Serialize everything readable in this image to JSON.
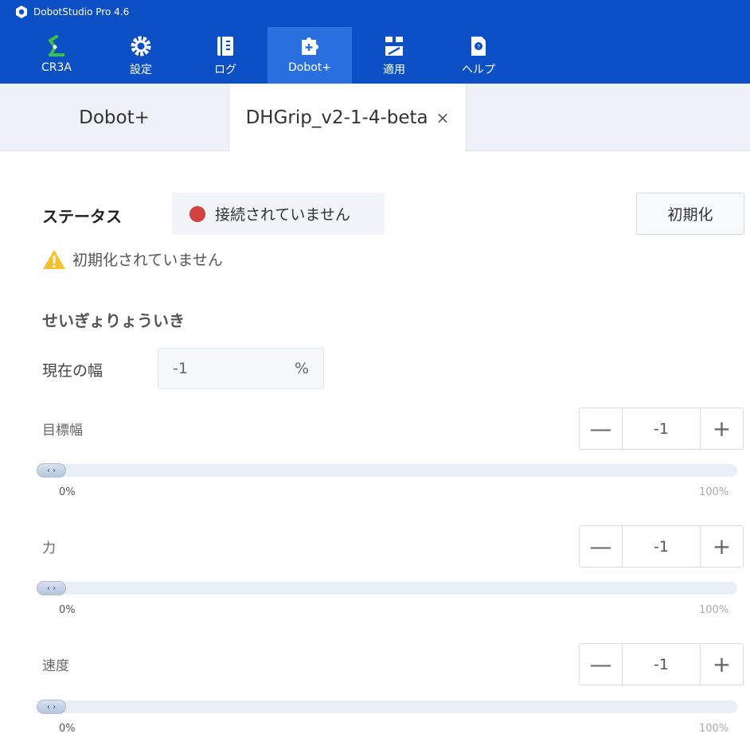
{
  "app": {
    "title": "DobotStudio Pro 4.6"
  },
  "nav": [
    {
      "label": "CR3A",
      "icon": "robot-arm-icon"
    },
    {
      "label": "設定",
      "icon": "gear-icon"
    },
    {
      "label": "ログ",
      "icon": "log-book-icon"
    },
    {
      "label": "Dobot+",
      "icon": "puzzle-plus-icon",
      "active": true
    },
    {
      "label": "適用",
      "icon": "apply-blocks-icon"
    },
    {
      "label": "ヘルプ",
      "icon": "help-doc-icon"
    }
  ],
  "tabs": [
    {
      "label": "Dobot+"
    },
    {
      "label": "DHGrip_v2-1-4-beta",
      "close": "×",
      "active": true
    }
  ],
  "status": {
    "heading": "ステータス",
    "value": "接続されていません",
    "init_button": "初期化",
    "warning": "初期化されていません"
  },
  "control": {
    "heading": "せいぎょりょういき",
    "current_width_label": "現在の幅",
    "current_width_value": "-1",
    "current_width_unit": "%",
    "sliders": [
      {
        "label": "目標幅",
        "value": "-1",
        "min_label": "0%",
        "max_label": "100%",
        "position": 0
      },
      {
        "label": "力",
        "value": "-1",
        "min_label": "0%",
        "max_label": "100%",
        "position": 0
      },
      {
        "label": "速度",
        "value": "-1",
        "min_label": "0%",
        "max_label": "100%",
        "position": 0
      }
    ],
    "minus": "—",
    "plus": "+",
    "handle_glyph": "‹ ›"
  },
  "colors": {
    "topbar": "#0a4fc4",
    "active_nav": "#2a6fe0",
    "status_dot": "#d0413f",
    "warning": "#f2c232"
  }
}
